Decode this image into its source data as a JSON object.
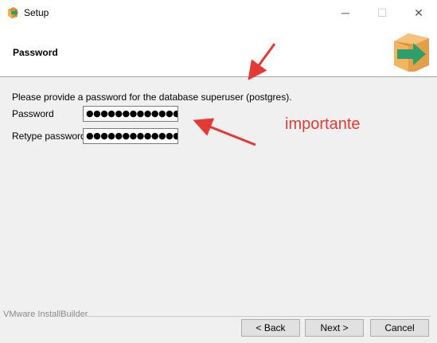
{
  "window": {
    "title": "Setup",
    "app_icon": "installer-box-icon",
    "controls": {
      "minimize": "─",
      "maximize": "☐",
      "close": "✕"
    }
  },
  "header": {
    "title": "Password",
    "logo": "installer-box-arrow-icon"
  },
  "main": {
    "intro_text": "Please provide a password for the database superuser (postgres).",
    "fields": [
      {
        "label": "Password",
        "value": "●●●●●●●●●●●●●"
      },
      {
        "label": "Retype password",
        "value": "●●●●●●●●●●●●●"
      }
    ],
    "annotation": "importante"
  },
  "footer": {
    "brand": "VMware InstallBuilder",
    "buttons": {
      "back": "< Back",
      "next": "Next >",
      "cancel": "Cancel"
    }
  },
  "colors": {
    "annotation": "#e53935",
    "header_bg": "#ffffff",
    "content_bg": "#f0f0f0",
    "logo_box": "#e8a33c",
    "logo_arrow": "#2e9e6b"
  }
}
